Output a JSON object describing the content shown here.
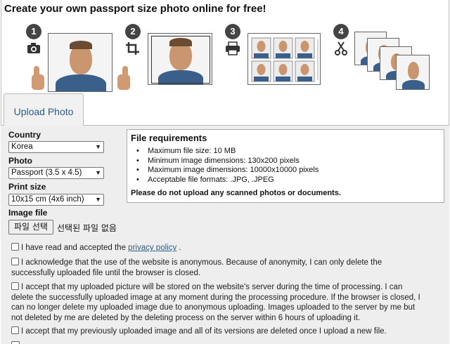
{
  "page": {
    "title": "Create your own passport size photo online for free!"
  },
  "steps": [
    {
      "number": "1",
      "icon": "camera-icon"
    },
    {
      "number": "2",
      "icon": "crop-icon"
    },
    {
      "number": "3",
      "icon": "printer-icon"
    },
    {
      "number": "4",
      "icon": "scissors-icon"
    }
  ],
  "tabs": [
    {
      "label": "Upload Photo"
    }
  ],
  "form": {
    "country_label": "Country",
    "country_value": "Korea",
    "photo_label": "Photo",
    "photo_value": "Passport (3.5 x 4.5)",
    "print_label": "Print size",
    "print_value": "10x15 cm (4x6 inch)",
    "image_label": "Image file",
    "file_button": "파일 선택",
    "file_status": "선택된 파일 없음"
  },
  "requirements": {
    "title": "File requirements",
    "items": [
      "Maximum file size: 10 MB",
      "Minimum image dimensions: 130x200 pixels",
      "Maximum image dimensions: 10000x10000 pixels",
      "Acceptable file formats: .JPG, .JPEG"
    ],
    "warning": "Please do not upload any scanned photos or documents."
  },
  "consents": {
    "privacy_pre": "I have read and accepted the ",
    "privacy_link": "privacy policy",
    "privacy_post": " .",
    "anonymous": "I acknowledge that the use of the website is anonymous. Because of anonymity, I can only delete the successfully uploaded file until the browser is closed.",
    "storage": "I accept that my uploaded picture will be stored on the website's server during the time of processing. I can delete the successfully uploaded image at any moment during the processing procedure. If the browser is closed, I can no longer delete my uploaded image due to anonymous uploading. Images uploaded to the server by me but not deleted by me are deleted by the deleting process on the server within 6 hours of uploading it.",
    "replace": "I accept that my previously uploaded image and all of its versions are deleted once I upload a new file."
  }
}
